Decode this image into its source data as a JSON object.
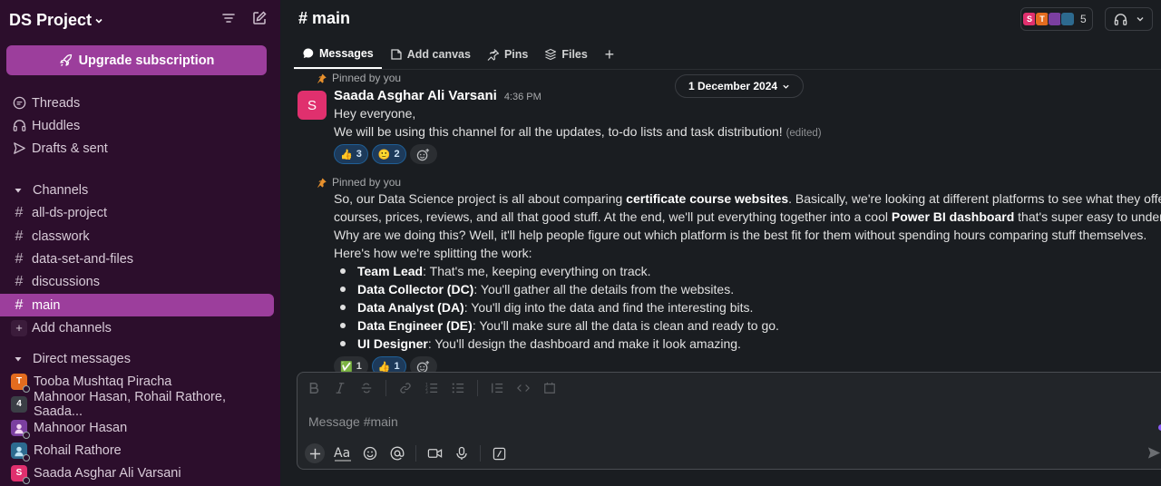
{
  "workspace": {
    "name": "DS Project",
    "upgrade_label": "Upgrade subscription"
  },
  "nav": {
    "threads": "Threads",
    "huddles": "Huddles",
    "drafts": "Drafts & sent"
  },
  "channels": {
    "header": "Channels",
    "items": [
      "all-ds-project",
      "classwork",
      "data-set-and-files",
      "discussions",
      "main"
    ],
    "add_label": "Add channels"
  },
  "direct_messages": {
    "header": "Direct messages",
    "items": [
      {
        "name": "Tooba Mushtaq Piracha",
        "initial": "T",
        "color": "#e36c1f"
      },
      {
        "name": "Mahnoor Hasan, Rohail Rathore, Saada...",
        "initial": "4",
        "color": "#3b3f46"
      },
      {
        "name": "Mahnoor Hasan",
        "initial": "",
        "color": "#7b3fa0"
      },
      {
        "name": "Rohail Rathore",
        "initial": "",
        "color": "#2d6a8f"
      },
      {
        "name": "Saada Asghar Ali Varsani",
        "initial": "S",
        "color": "#e0306e"
      }
    ]
  },
  "channel": {
    "title": "main",
    "member_count": "5"
  },
  "tabs": [
    "Messages",
    "Add canvas",
    "Pins",
    "Files"
  ],
  "date_divider": "1 December 2024",
  "message1": {
    "pinned_label": "Pinned by you",
    "avatar_initial": "S",
    "author": "Saada Asghar Ali Varsani",
    "time": "4:36 PM",
    "line1": "Hey everyone,",
    "line2": "We will be using this channel for all the updates, to-do lists and task distribution!",
    "edited": "(edited)",
    "reactions": [
      {
        "emoji": "👍",
        "count": "3"
      },
      {
        "emoji": "🙂",
        "count": "2"
      }
    ]
  },
  "message2": {
    "pinned_label": "Pinned by you",
    "p1_a": "So, our Data Science project is all about comparing ",
    "p1_b": "certificate course websites",
    "p1_c": ". Basically, we're looking at different platforms to see what they offer, lik",
    "p2_a": "courses, prices, reviews, and all that good stuff. At the end, we'll put everything together into a cool ",
    "p2_b": "Power BI dashboard",
    "p2_c": " that's super easy to understan",
    "p3": "Why are we doing this? Well, it'll help people figure out which platform is the best fit for them without spending hours comparing stuff themselves.",
    "p4": "Here's how we're splitting the work:",
    "bullets": [
      {
        "role": "Team Lead",
        "desc": ": That's me, keeping everything on track."
      },
      {
        "role": "Data Collector (DC)",
        "desc": ": You'll gather all the details from the websites."
      },
      {
        "role": "Data Analyst (DA)",
        "desc": ": You'll dig into the data and find the interesting bits."
      },
      {
        "role": "Data Engineer (DE)",
        "desc": ": You'll make sure all the data is clean and ready to go."
      },
      {
        "role": "UI Designer",
        "desc": ": You'll design the dashboard and make it look amazing."
      }
    ],
    "reactions": [
      {
        "emoji": "✅",
        "count": "1"
      },
      {
        "emoji": "👍",
        "count": "1"
      }
    ]
  },
  "composer": {
    "placeholder": "Message #main"
  },
  "colors": {
    "sidebar": "#2c0e2c",
    "accent": "#9c3e9c",
    "main_bg": "#1a1d21"
  }
}
